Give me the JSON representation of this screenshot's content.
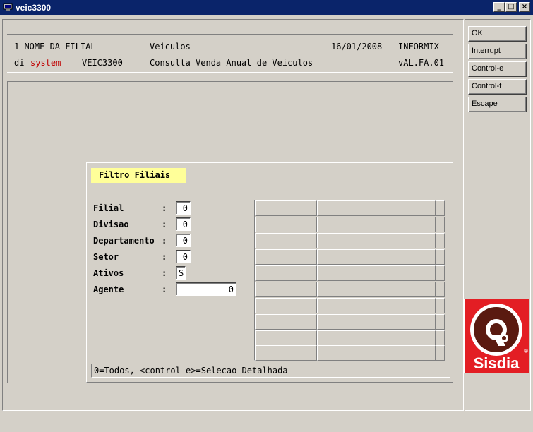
{
  "window": {
    "title": "veic3300"
  },
  "header": {
    "line1": {
      "filial": "1-NOME DA FILIAL",
      "module": "Veiculos",
      "date": "16/01/2008",
      "db": "INFORMIX"
    },
    "line2": {
      "brand_prefix": "di",
      "brand_suffix": "system",
      "program": "VEIC3300",
      "description": "Consulta Venda Anual de Veiculos",
      "version": "vAL.FA.01"
    }
  },
  "actions": [
    "OK",
    "Interrupt",
    "Control-e",
    "Control-f",
    "Escape"
  ],
  "filter": {
    "title": "Filtro Filiais",
    "fields": [
      {
        "label": "Filial",
        "value": "0"
      },
      {
        "label": "Divisao",
        "value": "0"
      },
      {
        "label": "Departamento",
        "value": "0"
      },
      {
        "label": "Setor",
        "value": "0"
      },
      {
        "label": "Ativos",
        "value": "S"
      },
      {
        "label": "Agente",
        "value": "0"
      }
    ]
  },
  "status": "0=Todos, <control-e>=Selecao Detalhada",
  "logo": {
    "text": "Sisdia",
    "registered": "®"
  },
  "colors": {
    "titlebar": "#0a246a",
    "highlight": "#ffff99",
    "brand_red": "#e31e24",
    "brand_brown": "#5a1a10",
    "face": "#d4d0c8"
  }
}
